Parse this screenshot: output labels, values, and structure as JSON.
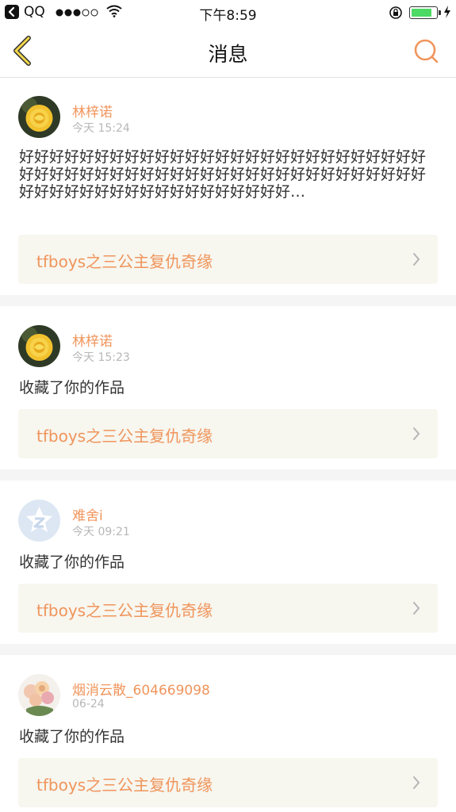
{
  "status_bar": {
    "carrier": "QQ",
    "time": "下午8:59",
    "battery_percent": 85,
    "accent": "#4cd964"
  },
  "nav": {
    "title": "消息",
    "back_icon": "chevron-left-icon",
    "search_icon": "search-icon",
    "accent": "#f0955c"
  },
  "messages": [
    {
      "user": "林梓诺",
      "time": "今天 15:24",
      "text": "好好好好好好好好好好好好好好好好好好好好好好好好好好好好好好好好好好好好好好好好好好好好好好好好好好好好好好好好好好好好好好好好好好好好好好好好…",
      "work": "tfboys之三公主复仇奇缘",
      "avatar": "yellow-rose"
    },
    {
      "user": "林梓诺",
      "time": "今天 15:23",
      "text": "收藏了你的作品",
      "work": "tfboys之三公主复仇奇缘",
      "avatar": "yellow-rose"
    },
    {
      "user": "难舍i",
      "time": "今天 09:21",
      "text": "收藏了你的作品",
      "work": "tfboys之三公主复仇奇缘",
      "avatar": "default-qzone"
    },
    {
      "user": "烟消云散_604669098",
      "time": "06-24",
      "text": "收藏了你的作品",
      "work": "tfboys之三公主复仇奇缘",
      "avatar": "flower-bouquet"
    }
  ]
}
